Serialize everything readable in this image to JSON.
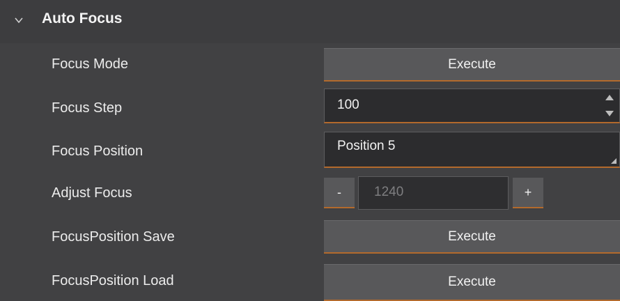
{
  "section": {
    "title": "Auto Focus",
    "icon": "chevron-down-icon"
  },
  "rows": {
    "focus_mode": {
      "label": "Focus Mode",
      "button": "Execute"
    },
    "focus_step": {
      "label": "Focus Step",
      "value": "100"
    },
    "focus_position": {
      "label": "Focus Position",
      "value": "Position 5"
    },
    "adjust_focus": {
      "label": "Adjust Focus",
      "minus": "-",
      "value": "1240",
      "plus": "+"
    },
    "position_save": {
      "label": "FocusPosition Save",
      "button": "Execute"
    },
    "position_load": {
      "label": "FocusPosition Load",
      "button": "Execute"
    }
  },
  "colors": {
    "background": "#414143",
    "button": "#58585a",
    "accent_underline": "#b36a2c",
    "field": "#2c2c2e"
  }
}
